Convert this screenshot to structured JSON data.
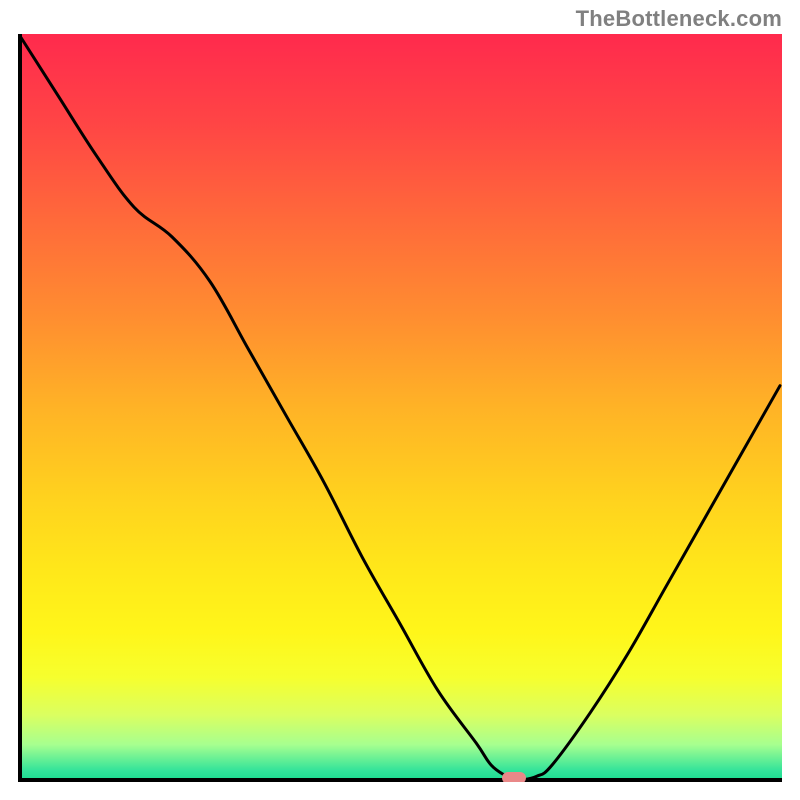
{
  "attribution": "TheBottleneck.com",
  "chart_data": {
    "type": "line",
    "title": "",
    "xlabel": "",
    "ylabel": "",
    "xlim": [
      0,
      100
    ],
    "ylim": [
      0,
      100
    ],
    "x": [
      0,
      5,
      10,
      15,
      20,
      25,
      30,
      35,
      40,
      45,
      50,
      55,
      60,
      62,
      64,
      65,
      66,
      68,
      70,
      75,
      80,
      85,
      90,
      95,
      100
    ],
    "values": [
      100,
      92,
      84,
      77,
      73,
      67,
      58,
      49,
      40,
      30,
      21,
      12,
      5,
      2,
      0.5,
      0,
      0,
      0.5,
      2,
      9,
      17,
      26,
      35,
      44,
      53
    ],
    "marker": {
      "x": 65,
      "y": 0,
      "color": "#e98888"
    },
    "gradient_stops": [
      {
        "offset": 0.0,
        "color": "#ff2a4d"
      },
      {
        "offset": 0.12,
        "color": "#ff4545"
      },
      {
        "offset": 0.25,
        "color": "#ff6a3a"
      },
      {
        "offset": 0.38,
        "color": "#ff8e30"
      },
      {
        "offset": 0.5,
        "color": "#ffb326"
      },
      {
        "offset": 0.62,
        "color": "#ffd21e"
      },
      {
        "offset": 0.72,
        "color": "#ffe81a"
      },
      {
        "offset": 0.8,
        "color": "#fff61a"
      },
      {
        "offset": 0.86,
        "color": "#f6ff2e"
      },
      {
        "offset": 0.91,
        "color": "#dbff60"
      },
      {
        "offset": 0.95,
        "color": "#a7ff8f"
      },
      {
        "offset": 0.985,
        "color": "#32e39a"
      },
      {
        "offset": 1.0,
        "color": "#17d98f"
      }
    ],
    "axis": {
      "stroke": "#000000",
      "width": 4
    },
    "curve": {
      "stroke": "#000000",
      "width": 3
    }
  }
}
